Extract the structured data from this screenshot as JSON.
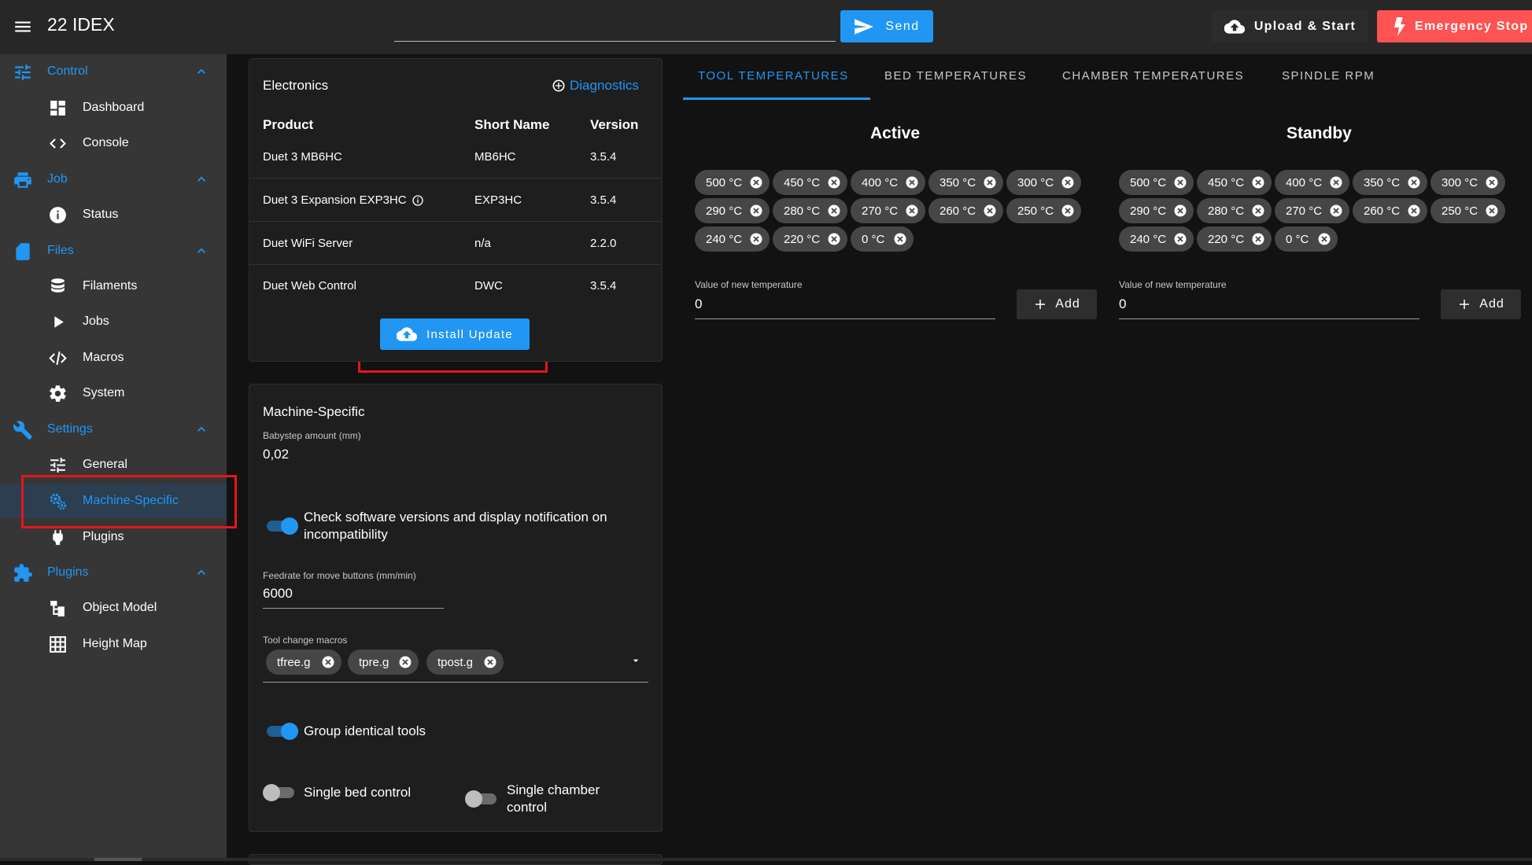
{
  "app": {
    "title": "22 IDEX",
    "command_placeholder": "",
    "send_label": "Send",
    "upload_label": "Upload & Start",
    "estop_label": "Emergency Stop",
    "colors": {
      "accent": "#2196f3",
      "danger": "#ff5252",
      "highlight": "#e8141b"
    }
  },
  "sidebar": {
    "groups": [
      {
        "label": "Control",
        "icon": "tune-icon",
        "items": [
          {
            "label": "Dashboard",
            "icon": "dashboard-icon"
          },
          {
            "label": "Console",
            "icon": "code-icon"
          }
        ]
      },
      {
        "label": "Job",
        "icon": "printer-icon",
        "items": [
          {
            "label": "Status",
            "icon": "info-icon"
          }
        ]
      },
      {
        "label": "Files",
        "icon": "sd-card-icon",
        "items": [
          {
            "label": "Filaments",
            "icon": "database-icon"
          },
          {
            "label": "Jobs",
            "icon": "play-icon"
          },
          {
            "label": "Macros",
            "icon": "code-braces-icon"
          },
          {
            "label": "System",
            "icon": "gear-icon"
          }
        ]
      },
      {
        "label": "Settings",
        "icon": "wrench-icon",
        "items": [
          {
            "label": "General",
            "icon": "sliders-icon"
          },
          {
            "label": "Machine-Specific",
            "icon": "cogs-icon",
            "active": true
          },
          {
            "label": "Plugins",
            "icon": "power-plug-icon"
          }
        ]
      },
      {
        "label": "Plugins",
        "icon": "puzzle-icon",
        "items": [
          {
            "label": "Object Model",
            "icon": "file-tree-icon"
          },
          {
            "label": "Height Map",
            "icon": "grid-icon"
          }
        ]
      }
    ]
  },
  "electronics": {
    "title": "Electronics",
    "diagnostics_label": "Diagnostics",
    "headers": [
      "Product",
      "Short Name",
      "Version"
    ],
    "rows": [
      {
        "product": "Duet 3 MB6HC",
        "short": "MB6HC",
        "version": "3.5.4"
      },
      {
        "product": "Duet 3 Expansion EXP3HC",
        "short": "EXP3HC",
        "version": "3.5.4"
      },
      {
        "product": "Duet WiFi Server",
        "short": "n/a",
        "version": "2.2.0"
      },
      {
        "product": "Duet Web Control",
        "short": "DWC",
        "version": "3.5.4"
      }
    ],
    "install_label": "Install Update"
  },
  "machine": {
    "title": "Machine-Specific",
    "babystep_label": "Babystep amount (mm)",
    "babystep_value": "0,02",
    "check_versions_label": "Check software versions and display notification on incompatibility",
    "check_versions_on": true,
    "feedrate_label": "Feedrate for move buttons (mm/min)",
    "feedrate_value": "6000",
    "tool_change_label": "Tool change macros",
    "tool_change_macros": [
      "tfree.g",
      "tpre.g",
      "tpost.g"
    ],
    "group_tools_label": "Group identical tools",
    "group_tools_on": true,
    "single_bed_label": "Single bed control",
    "single_bed_on": false,
    "single_chamber_label": "Single chamber control",
    "single_chamber_on": false
  },
  "temperatures": {
    "tabs": [
      "TOOL TEMPERATURES",
      "BED TEMPERATURES",
      "CHAMBER TEMPERATURES",
      "SPINDLE RPM"
    ],
    "active_tab": 0,
    "active": {
      "title": "Active",
      "chips": [
        "500 °C",
        "450 °C",
        "400 °C",
        "350 °C",
        "300 °C",
        "290 °C",
        "280 °C",
        "270 °C",
        "260 °C",
        "250 °C",
        "240 °C",
        "220 °C",
        "0 °C"
      ],
      "new_label": "Value of new temperature",
      "new_value": "0",
      "add_label": "Add"
    },
    "standby": {
      "title": "Standby",
      "chips": [
        "500 °C",
        "450 °C",
        "400 °C",
        "350 °C",
        "300 °C",
        "290 °C",
        "280 °C",
        "270 °C",
        "260 °C",
        "250 °C",
        "240 °C",
        "220 °C",
        "0 °C"
      ],
      "new_label": "Value of new temperature",
      "new_value": "0",
      "add_label": "Add"
    }
  }
}
